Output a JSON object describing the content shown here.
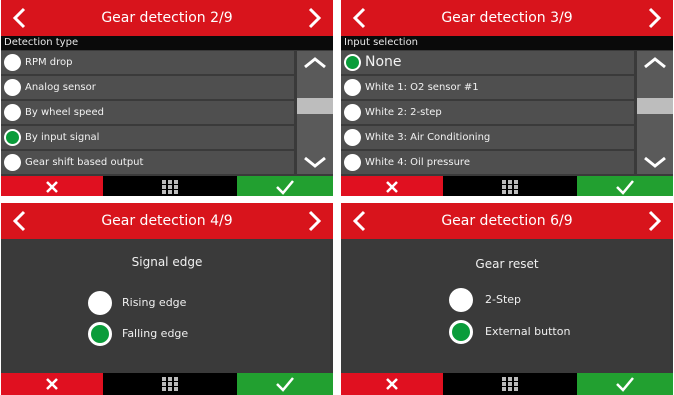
{
  "panels": [
    {
      "title": "Gear detection 2/9",
      "subtitle": "Detection type",
      "items": [
        {
          "label": "RPM drop",
          "selected": false
        },
        {
          "label": "Analog sensor",
          "selected": false
        },
        {
          "label": "By wheel speed",
          "selected": false
        },
        {
          "label": "By input signal",
          "selected": true
        },
        {
          "label": "Gear shift based output",
          "selected": false
        }
      ]
    },
    {
      "title": "Gear detection 3/9",
      "subtitle": "Input selection",
      "items": [
        {
          "label": "None",
          "selected": true
        },
        {
          "label": "White 1: O2 sensor #1",
          "selected": false
        },
        {
          "label": "White 2: 2-step",
          "selected": false
        },
        {
          "label": "White 3: Air Conditioning",
          "selected": false
        },
        {
          "label": "White 4: Oil pressure",
          "selected": false
        }
      ]
    },
    {
      "title": "Gear detection 4/9",
      "heading": "Signal edge",
      "options": [
        {
          "label": "Rising edge",
          "selected": false
        },
        {
          "label": "Falling edge",
          "selected": true
        }
      ]
    },
    {
      "title": "Gear detection 6/9",
      "heading": "Gear reset",
      "options": [
        {
          "label": "2-Step",
          "selected": false
        },
        {
          "label": "External button",
          "selected": true
        }
      ]
    }
  ],
  "colors": {
    "header": "#d8141c",
    "cancel": "#e01020",
    "confirm": "#22a030",
    "selected_radio": "#0a9c3a",
    "background": "#3a3a3a"
  },
  "icons": {
    "prev": "chevron-left-icon",
    "next": "chevron-right-icon",
    "cancel": "close-icon",
    "menu": "grid-icon",
    "confirm": "checkmark-icon",
    "scroll_up": "chevron-up-icon",
    "scroll_down": "chevron-down-icon"
  }
}
